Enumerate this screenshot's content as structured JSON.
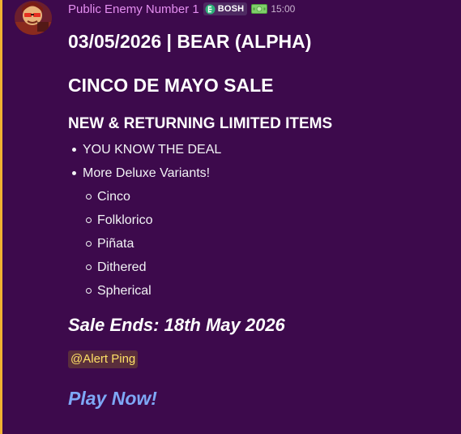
{
  "author": {
    "name": "Public Enemy Number 1",
    "tag": "BOSH",
    "timestamp": "15:00"
  },
  "message": {
    "heading_date": "03/05/2026 | BEAR (ALPHA)",
    "heading_sale": "CINCO DE MAYO SALE",
    "heading_items": "NEW & RETURNING LIMITED ITEMS",
    "bullets": [
      "YOU KNOW THE DEAL",
      "More Deluxe Variants!"
    ],
    "variants": [
      "Cinco",
      "Folklorico",
      "Piñata",
      "Dithered",
      "Spherical"
    ],
    "sale_ends": "Sale Ends: 18th May 2026",
    "mention": "@Alert Ping",
    "play_link": "Play Now!"
  },
  "colors": {
    "background": "#3d0a4c",
    "username": "#e48ef0",
    "mention_text": "#ffe066",
    "link": "#7ea8f6",
    "accent_border": "#f0b232"
  },
  "icons": {
    "tag_icon": "bosh-tag-icon",
    "money_icon": "money-bill-icon"
  }
}
